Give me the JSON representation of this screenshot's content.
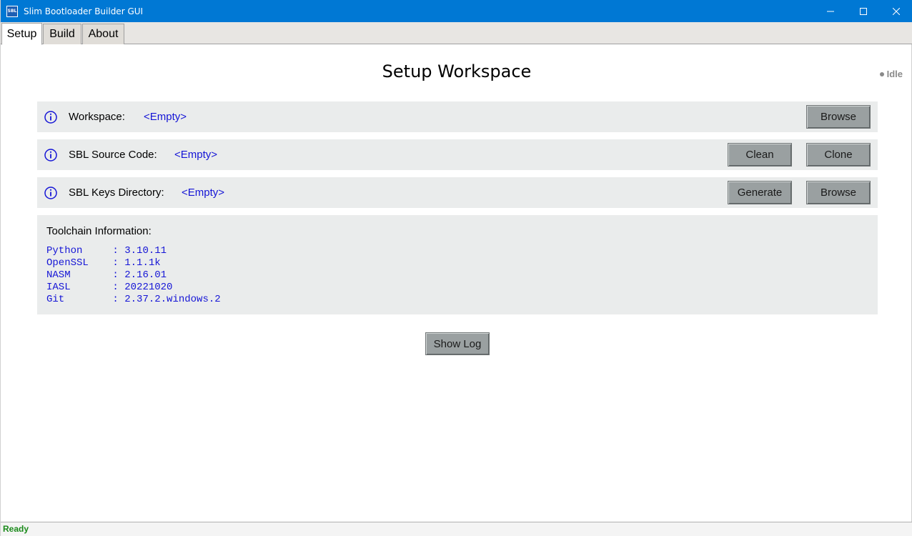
{
  "window": {
    "title": "Slim Bootloader Builder GUI",
    "icon_text": "SBL"
  },
  "tabs": [
    {
      "label": "Setup",
      "active": true
    },
    {
      "label": "Build",
      "active": false
    },
    {
      "label": "About",
      "active": false
    }
  ],
  "main": {
    "title": "Setup Workspace",
    "status": "Idle"
  },
  "rows": [
    {
      "label": "Workspace:",
      "value": "<Empty>",
      "buttons": [
        "Browse"
      ]
    },
    {
      "label": "SBL Source Code:",
      "value": "<Empty>",
      "buttons": [
        "Clean",
        "Clone"
      ]
    },
    {
      "label": "SBL Keys Directory:",
      "value": "<Empty>",
      "buttons": [
        "Generate",
        "Browse"
      ]
    }
  ],
  "toolchain": {
    "title": "Toolchain Information:",
    "items": [
      {
        "name": "Python",
        "value": "3.10.11"
      },
      {
        "name": "OpenSSL",
        "value": "1.1.1k"
      },
      {
        "name": "NASM",
        "value": "2.16.01"
      },
      {
        "name": "IASL",
        "value": "20221020"
      },
      {
        "name": "Git",
        "value": "2.37.2.windows.2"
      }
    ]
  },
  "actions": {
    "show_log": "Show Log"
  },
  "statusbar": {
    "text": "Ready"
  },
  "colors": {
    "titlebar": "#0078d4",
    "value_text": "#1515d6",
    "ready_text": "#1a8a1a"
  }
}
